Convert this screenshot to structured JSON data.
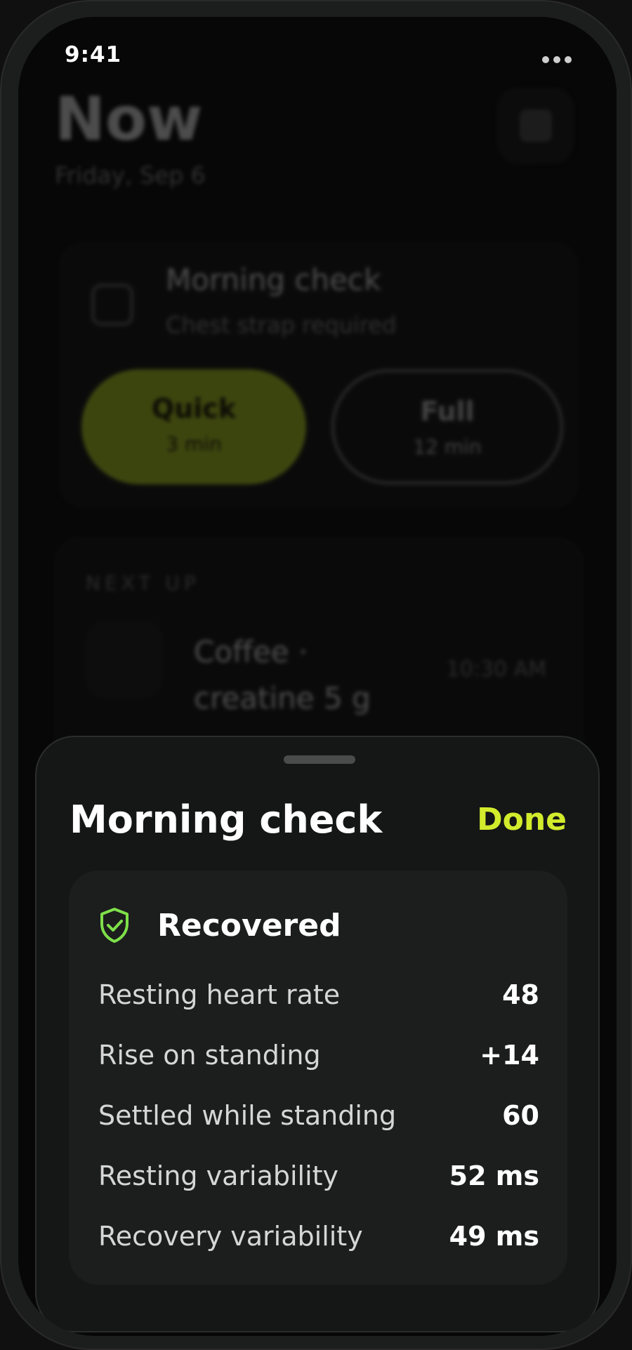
{
  "status_bar": {
    "time": "9:41"
  },
  "background": {
    "title": "Now",
    "date": "Friday, Sep 6",
    "check_card": {
      "title": "Morning check",
      "subtitle": "Chest strap required",
      "quick": {
        "label": "Quick",
        "duration": "3 min"
      },
      "full": {
        "label": "Full",
        "duration": "12 min"
      }
    },
    "next_up": {
      "heading": "NEXT UP",
      "item_title": "Coffee · creatine 5 g",
      "item_time": "10:30 AM"
    }
  },
  "sheet": {
    "title": "Morning check",
    "done_label": "Done",
    "status": "Recovered",
    "metrics": [
      {
        "label": "Resting heart rate",
        "value": "48"
      },
      {
        "label": "Rise on standing",
        "value": "+14"
      },
      {
        "label": "Settled while standing",
        "value": "60"
      },
      {
        "label": "Resting variability",
        "value": "52 ms"
      },
      {
        "label": "Recovery variability",
        "value": "49 ms"
      }
    ]
  },
  "colors": {
    "accent": "#d2ec2c",
    "status_ok": "#7ee04a",
    "sheet_bg": "#151616",
    "card_bg": "#1c1d1d"
  },
  "icons": {
    "status": "shield-check-icon",
    "more": "more-dots-icon"
  }
}
